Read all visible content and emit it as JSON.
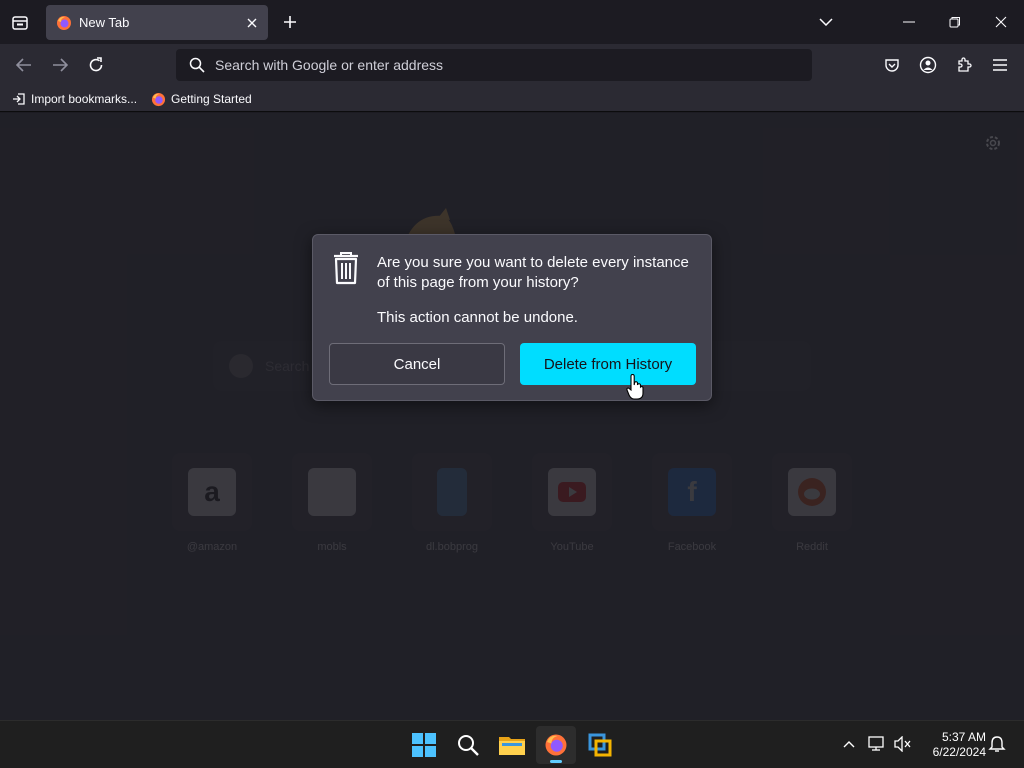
{
  "browser": {
    "tab_title": "New Tab",
    "url_placeholder": "Search with Google or enter address",
    "bookmarks": [
      {
        "label": "Import bookmarks..."
      },
      {
        "label": "Getting Started"
      }
    ]
  },
  "newtab": {
    "search_placeholder": "Search",
    "shortcuts": [
      {
        "label": "@amazon",
        "icon": "amazon-icon"
      },
      {
        "label": "mobls",
        "icon": "mobile-icon"
      },
      {
        "label": "dl.bobprog",
        "icon": "document-icon"
      },
      {
        "label": "YouTube",
        "icon": "youtube-icon"
      },
      {
        "label": "Facebook",
        "icon": "facebook-icon"
      },
      {
        "label": "Reddit",
        "icon": "reddit-icon"
      }
    ]
  },
  "dialog": {
    "message": "Are you sure you want to delete every instance of this page from your history?",
    "submessage": "This action cannot be undone.",
    "cancel_label": "Cancel",
    "confirm_label": "Delete from History",
    "accent": "#00ddff"
  },
  "taskbar": {
    "time": "5:37 AM",
    "date": "6/22/2024",
    "apps": [
      "start",
      "search",
      "file-explorer",
      "firefox",
      "virtualbox"
    ]
  }
}
